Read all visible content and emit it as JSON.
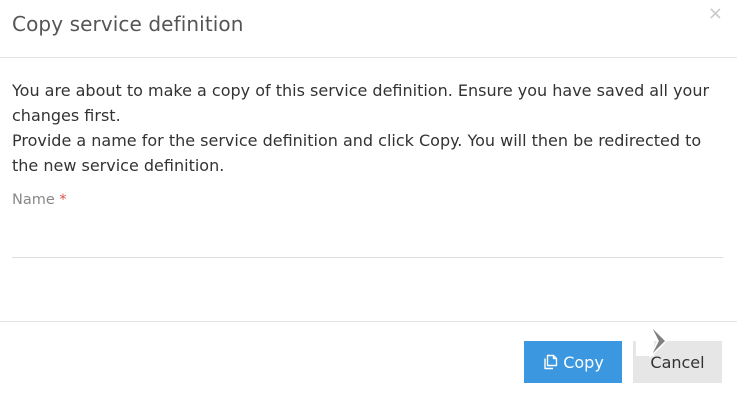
{
  "dialog": {
    "title": "Copy service definition",
    "close_symbol": "×",
    "message_line1": "You are about to make a copy of this service definition. Ensure you have saved all your changes first.",
    "message_line2": "Provide a name for the service definition and click Copy. You will then be redirected to the new service definition.",
    "name_field": {
      "label": "Name",
      "required_marker": "*",
      "value": "",
      "placeholder": ""
    },
    "buttons": {
      "copy_label": "Copy",
      "copy_icon": "copy-icon",
      "cancel_label": "Cancel"
    },
    "colors": {
      "primary": "#3a97e0",
      "secondary": "#e6e6e6",
      "required": "#d9534f"
    }
  }
}
